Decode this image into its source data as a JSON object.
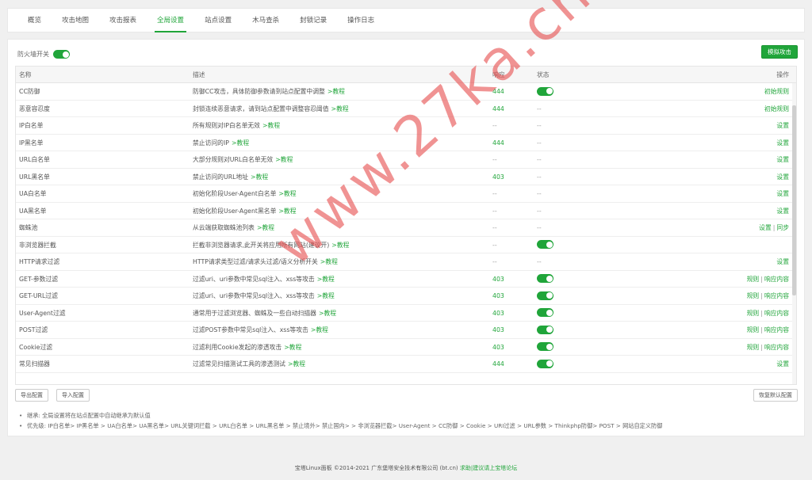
{
  "tabs": [
    "概览",
    "攻击地图",
    "攻击报表",
    "全局设置",
    "站点设置",
    "木马查杀",
    "封锁记录",
    "操作日志"
  ],
  "active_tab": "全局设置",
  "firewall_label": "防火墙开关",
  "simulate_button": "模拟攻击",
  "table": {
    "headers": {
      "name": "名称",
      "desc": "描述",
      "resp": "响应",
      "status": "状态",
      "op": "操作"
    },
    "rows": [
      {
        "name": "CC防御",
        "desc": "防御CC攻击，具体防御参数请到站点配置中调整",
        "tutorial": ">教程",
        "resp": "444",
        "status": "on",
        "ops": [
          "初始规则"
        ]
      },
      {
        "name": "恶意容忍度",
        "desc": "封锁连续恶意请求，请到站点配置中调整容忍阈值",
        "tutorial": ">教程",
        "resp": "444",
        "status": "--",
        "ops": [
          "初始规则"
        ]
      },
      {
        "name": "IP白名单",
        "desc": "所有规则对IP白名单无效",
        "tutorial": ">教程",
        "resp": "--",
        "status": "--",
        "ops": [
          "设置"
        ]
      },
      {
        "name": "IP黑名单",
        "desc": "禁止访问的IP",
        "tutorial": ">教程",
        "resp": "444",
        "status": "--",
        "ops": [
          "设置"
        ]
      },
      {
        "name": "URL白名单",
        "desc": "大部分规则对URL白名单无效",
        "tutorial": ">教程",
        "resp": "--",
        "status": "--",
        "ops": [
          "设置"
        ]
      },
      {
        "name": "URL黑名单",
        "desc": "禁止访问的URL地址",
        "tutorial": ">教程",
        "resp": "403",
        "status": "--",
        "ops": [
          "设置"
        ]
      },
      {
        "name": "UA白名单",
        "desc": "初始化阶段User-Agent白名单",
        "tutorial": ">教程",
        "resp": "--",
        "status": "--",
        "ops": [
          "设置"
        ]
      },
      {
        "name": "UA黑名单",
        "desc": "初始化阶段User-Agent黑名单",
        "tutorial": ">教程",
        "resp": "--",
        "status": "--",
        "ops": [
          "设置"
        ]
      },
      {
        "name": "蜘蛛池",
        "desc": "从云端获取蜘蛛池列表",
        "tutorial": ">教程",
        "resp": "--",
        "status": "--",
        "ops": [
          "设置",
          "同步"
        ]
      },
      {
        "name": "非浏览器拦截",
        "desc": "拦截非浏览器请求,此开关将应用所有网站(建议开)",
        "tutorial": ">教程",
        "resp": "--",
        "status": "on",
        "ops": []
      },
      {
        "name": "HTTP请求过滤",
        "desc": "HTTP请求类型过滤/请求头过滤/语义分析开关",
        "tutorial": ">教程",
        "resp": "--",
        "status": "--",
        "ops": [
          "设置"
        ]
      },
      {
        "name": "GET-参数过滤",
        "desc": "过滤uri、uri参数中常见sql注入、xss等攻击",
        "tutorial": ">教程",
        "resp": "403",
        "status": "on",
        "ops": [
          "规则",
          "响应内容"
        ]
      },
      {
        "name": "GET-URL过滤",
        "desc": "过滤uri、uri参数中常见sql注入、xss等攻击",
        "tutorial": ">教程",
        "resp": "403",
        "status": "on",
        "ops": [
          "规则",
          "响应内容"
        ]
      },
      {
        "name": "User-Agent过滤",
        "desc": "通常用于过滤浏览器、蜘蛛及一些自动扫描器",
        "tutorial": ">教程",
        "resp": "403",
        "status": "on",
        "ops": [
          "规则",
          "响应内容"
        ]
      },
      {
        "name": "POST过滤",
        "desc": "过滤POST参数中常见sql注入、xss等攻击",
        "tutorial": ">教程",
        "resp": "403",
        "status": "on",
        "ops": [
          "规则",
          "响应内容"
        ]
      },
      {
        "name": "Cookie过滤",
        "desc": "过滤利用Cookie发起的渗透攻击",
        "tutorial": ">教程",
        "resp": "403",
        "status": "on",
        "ops": [
          "规则",
          "响应内容"
        ]
      },
      {
        "name": "常见扫描器",
        "desc": "过滤常见扫描测试工具的渗透测试",
        "tutorial": ">教程",
        "resp": "444",
        "status": "on",
        "ops": [
          "设置"
        ]
      }
    ]
  },
  "buttons": {
    "export": "导出配置",
    "import": "导入配置",
    "restore": "恢复默认配置"
  },
  "notes": [
    "继承: 全局设置将在站点配置中自动继承为默认值",
    "优先级: IP白名单> IP黑名单 > UA白名单> UA黑名单> URL关键词拦截 > URL白名单 > URL黑名单 > 禁止境外> 禁止国内> > 非浏览器拦截> User-Agent > CC防御 > Cookie > URI过滤 > URL参数 > Thinkphp防御> POST > 网站自定义防御"
  ],
  "footer": {
    "text": "宝塔Linux面板 ©2014-2021 广东堡塔安全技术有限公司 (bt.cn)",
    "link": "求助|建议请上宝塔论坛"
  },
  "watermark": "www.27ka.cn",
  "colors": {
    "accent": "#20a53a",
    "watermark": "#e65050"
  }
}
